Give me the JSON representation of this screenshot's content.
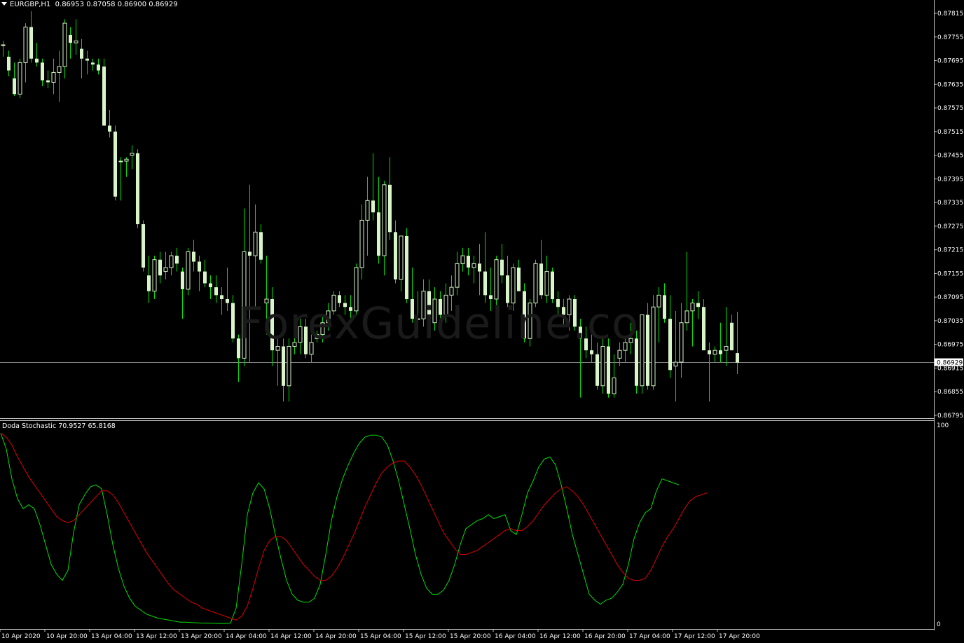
{
  "window": {
    "symbol": "EURGBP,H1",
    "ohlc": "0.86953 0.87058 0.86900 0.86929"
  },
  "watermark": "ForexGuideline.co",
  "indicator": {
    "label": "Doda Stochastic 70.9527 65.8168",
    "scale_top": "100",
    "scale_bottom": "0"
  },
  "price_axis": {
    "labels": [
      "0.87815",
      "0.87755",
      "0.87695",
      "0.87635",
      "0.87575",
      "0.87515",
      "0.87455",
      "0.87395",
      "0.87335",
      "0.87275",
      "0.87215",
      "0.87155",
      "0.87095",
      "0.87035",
      "0.86975",
      "0.86915",
      "0.86855",
      "0.86795"
    ],
    "current_price": "0.86929"
  },
  "time_axis": {
    "labels": [
      "10 Apr 2020",
      "10 Apr 20:00",
      "13 Apr 04:00",
      "13 Apr 12:00",
      "13 Apr 20:00",
      "14 Apr 04:00",
      "14 Apr 12:00",
      "14 Apr 20:00",
      "15 Apr 04:00",
      "15 Apr 12:00",
      "15 Apr 20:00",
      "16 Apr 04:00",
      "16 Apr 12:00",
      "16 Apr 20:00",
      "17 Apr 04:00",
      "17 Apr 12:00",
      "17 Apr 20:00"
    ]
  },
  "colors": {
    "background": "#000000",
    "candle": "#d8f5c8",
    "wick": "#00e000",
    "stoch_main": "#00e000",
    "stoch_signal": "#e00000",
    "price_line": "#b0b0b0"
  },
  "chart_data": [
    {
      "type": "candlestick",
      "title": "EURGBP,H1",
      "ylim": [
        0.86795,
        0.87835
      ],
      "candles": [
        [
          0.87735,
          0.87745,
          0.87705,
          0.87735
        ],
        [
          0.87705,
          0.8772,
          0.87655,
          0.8767
        ],
        [
          0.8765,
          0.8769,
          0.87605,
          0.8761
        ],
        [
          0.8761,
          0.877,
          0.876,
          0.8769
        ],
        [
          0.8769,
          0.8779,
          0.8764,
          0.8778
        ],
        [
          0.8778,
          0.8782,
          0.8769,
          0.877
        ],
        [
          0.877,
          0.8774,
          0.8768,
          0.8769
        ],
        [
          0.8769,
          0.877,
          0.8763,
          0.87645
        ],
        [
          0.87645,
          0.8767,
          0.87625,
          0.8764
        ],
        [
          0.8764,
          0.877,
          0.8761,
          0.87665
        ],
        [
          0.87665,
          0.8772,
          0.8759,
          0.8768
        ],
        [
          0.8768,
          0.878,
          0.8765,
          0.8779
        ],
        [
          0.8776,
          0.8778,
          0.877,
          0.8774
        ],
        [
          0.8774,
          0.878,
          0.8771,
          0.87745
        ],
        [
          0.87725,
          0.8775,
          0.8765,
          0.877
        ],
        [
          0.877,
          0.8772,
          0.8766,
          0.87695
        ],
        [
          0.8769,
          0.877,
          0.8767,
          0.87685
        ],
        [
          0.87685,
          0.877,
          0.8766,
          0.8767
        ],
        [
          0.8768,
          0.877,
          0.8753,
          0.8753
        ],
        [
          0.8753,
          0.8757,
          0.875,
          0.87515
        ],
        [
          0.87515,
          0.8753,
          0.8734,
          0.8735
        ],
        [
          0.8744,
          0.8745,
          0.8734,
          0.8744
        ],
        [
          0.8744,
          0.8745,
          0.874,
          0.87445
        ],
        [
          0.87455,
          0.8748,
          0.8742,
          0.8746
        ],
        [
          0.8746,
          0.8747,
          0.8727,
          0.8728
        ],
        [
          0.8728,
          0.8729,
          0.8716,
          0.8717
        ],
        [
          0.8715,
          0.872,
          0.8708,
          0.8711
        ],
        [
          0.8711,
          0.872,
          0.8709,
          0.8719
        ],
        [
          0.8719,
          0.8721,
          0.8713,
          0.8715
        ],
        [
          0.8716,
          0.8721,
          0.8714,
          0.8717
        ],
        [
          0.8717,
          0.8721,
          0.8715,
          0.872
        ],
        [
          0.872,
          0.8722,
          0.8716,
          0.8718
        ],
        [
          0.8716,
          0.8717,
          0.8704,
          0.87115
        ],
        [
          0.87115,
          0.8722,
          0.871,
          0.8721
        ],
        [
          0.8721,
          0.8724,
          0.8716,
          0.87185
        ],
        [
          0.87185,
          0.872,
          0.8711,
          0.8716
        ],
        [
          0.8716,
          0.8719,
          0.8712,
          0.8713
        ],
        [
          0.8713,
          0.8715,
          0.8709,
          0.8712
        ],
        [
          0.8712,
          0.8715,
          0.8708,
          0.871
        ],
        [
          0.871,
          0.8712,
          0.8705,
          0.8709
        ],
        [
          0.8709,
          0.8717,
          0.8706,
          0.8708
        ],
        [
          0.8708,
          0.871,
          0.8698,
          0.8699
        ],
        [
          0.8699,
          0.87,
          0.8688,
          0.8694
        ],
        [
          0.8694,
          0.8732,
          0.8692,
          0.8721
        ],
        [
          0.8721,
          0.8738,
          0.8693,
          0.872
        ],
        [
          0.872,
          0.8733,
          0.8707,
          0.8726
        ],
        [
          0.8726,
          0.8728,
          0.8718,
          0.8719
        ],
        [
          0.8708,
          0.872,
          0.87,
          0.8709
        ],
        [
          0.8709,
          0.8712,
          0.8692,
          0.8696
        ],
        [
          0.8696,
          0.8699,
          0.8687,
          0.8697
        ],
        [
          0.8697,
          0.8699,
          0.8683,
          0.8687
        ],
        [
          0.8687,
          0.8699,
          0.8683,
          0.8697
        ],
        [
          0.8697,
          0.8702,
          0.8695,
          0.8698
        ],
        [
          0.8698,
          0.8704,
          0.8695,
          0.8702
        ],
        [
          0.8702,
          0.8704,
          0.8694,
          0.8695
        ],
        [
          0.8695,
          0.87,
          0.8693,
          0.8698
        ],
        [
          0.8699,
          0.8701,
          0.8698,
          0.87
        ],
        [
          0.87,
          0.8705,
          0.8698,
          0.8703
        ],
        [
          0.8703,
          0.8708,
          0.8701,
          0.8706
        ],
        [
          0.8706,
          0.8711,
          0.8705,
          0.871
        ],
        [
          0.871,
          0.8711,
          0.8707,
          0.8708
        ],
        [
          0.8708,
          0.871,
          0.8705,
          0.8707
        ],
        [
          0.8707,
          0.871,
          0.8703,
          0.8706
        ],
        [
          0.8706,
          0.8718,
          0.8705,
          0.8717
        ],
        [
          0.8717,
          0.8733,
          0.8714,
          0.8729
        ],
        [
          0.8729,
          0.874,
          0.872,
          0.8734
        ],
        [
          0.8734,
          0.8746,
          0.8729,
          0.8731
        ],
        [
          0.8731,
          0.874,
          0.8718,
          0.872
        ],
        [
          0.872,
          0.8739,
          0.8715,
          0.8738
        ],
        [
          0.8738,
          0.8745,
          0.8724,
          0.8726
        ],
        [
          0.8726,
          0.8729,
          0.8713,
          0.8714
        ],
        [
          0.8714,
          0.8725,
          0.8711,
          0.8725
        ],
        [
          0.8725,
          0.8727,
          0.8708,
          0.8709
        ],
        [
          0.8709,
          0.8717,
          0.8703,
          0.8704
        ],
        [
          0.8704,
          0.8711,
          0.8701,
          0.8704
        ],
        [
          0.8704,
          0.8714,
          0.8702,
          0.8711
        ],
        [
          0.8711,
          0.8714,
          0.8702,
          0.8703
        ],
        [
          0.8703,
          0.8712,
          0.8701,
          0.8709
        ],
        [
          0.8709,
          0.8711,
          0.8704,
          0.8705
        ],
        [
          0.8705,
          0.8713,
          0.8703,
          0.871
        ],
        [
          0.871,
          0.8715,
          0.8706,
          0.8712
        ],
        [
          0.8712,
          0.8721,
          0.871,
          0.8718
        ],
        [
          0.8718,
          0.8722,
          0.8716,
          0.872
        ],
        [
          0.872,
          0.8722,
          0.8715,
          0.8717
        ],
        [
          0.8717,
          0.872,
          0.8713,
          0.8718
        ],
        [
          0.8718,
          0.8723,
          0.871,
          0.8716
        ],
        [
          0.8716,
          0.8726,
          0.8708,
          0.871
        ],
        [
          0.871,
          0.8717,
          0.8706,
          0.8709
        ],
        [
          0.8709,
          0.872,
          0.8705,
          0.8719
        ],
        [
          0.8719,
          0.8723,
          0.8713,
          0.8715
        ],
        [
          0.8715,
          0.872,
          0.8707,
          0.8708
        ],
        [
          0.8708,
          0.8718,
          0.8706,
          0.8717
        ],
        [
          0.8717,
          0.8719,
          0.8711,
          0.8711
        ],
        [
          0.8711,
          0.8713,
          0.8698,
          0.8699
        ],
        [
          0.8699,
          0.8709,
          0.8697,
          0.8708
        ],
        [
          0.8708,
          0.8719,
          0.8707,
          0.8718
        ],
        [
          0.8718,
          0.8724,
          0.8709,
          0.871
        ],
        [
          0.871,
          0.872,
          0.8708,
          0.8716
        ],
        [
          0.8716,
          0.8717,
          0.8708,
          0.8709
        ],
        [
          0.8709,
          0.8711,
          0.8705,
          0.8707
        ],
        [
          0.8707,
          0.8709,
          0.8702,
          0.8705
        ],
        [
          0.8705,
          0.871,
          0.8701,
          0.8709
        ],
        [
          0.8709,
          0.871,
          0.8701,
          0.8702
        ],
        [
          0.8702,
          0.8704,
          0.8684,
          0.8699
        ],
        [
          0.8699,
          0.8702,
          0.8694,
          0.8696
        ],
        [
          0.8696,
          0.87,
          0.8693,
          0.8695
        ],
        [
          0.8695,
          0.8698,
          0.8686,
          0.8687
        ],
        [
          0.8687,
          0.8699,
          0.8685,
          0.8697
        ],
        [
          0.8697,
          0.8699,
          0.8684,
          0.8685
        ],
        [
          0.8685,
          0.8695,
          0.8684,
          0.8689
        ],
        [
          0.8694,
          0.8698,
          0.8692,
          0.8696
        ],
        [
          0.8696,
          0.8699,
          0.8693,
          0.8698
        ],
        [
          0.8698,
          0.8703,
          0.8695,
          0.8699
        ],
        [
          0.8699,
          0.8701,
          0.8685,
          0.8687
        ],
        [
          0.8687,
          0.8705,
          0.8685,
          0.8705
        ],
        [
          0.8705,
          0.8708,
          0.8686,
          0.8687
        ],
        [
          0.8687,
          0.871,
          0.8686,
          0.8707
        ],
        [
          0.8707,
          0.8712,
          0.8698,
          0.871
        ],
        [
          0.871,
          0.8713,
          0.8703,
          0.8704
        ],
        [
          0.8704,
          0.871,
          0.8689,
          0.8691
        ],
        [
          0.8692,
          0.8706,
          0.8683,
          0.8693
        ],
        [
          0.8693,
          0.8708,
          0.8689,
          0.8703
        ],
        [
          0.8703,
          0.8721,
          0.8701,
          0.8706
        ],
        [
          0.8706,
          0.8709,
          0.8697,
          0.8708
        ],
        [
          0.8708,
          0.8711,
          0.8704,
          0.8707
        ],
        [
          0.8707,
          0.8709,
          0.8696,
          0.8696
        ],
        [
          0.8696,
          0.8698,
          0.8683,
          0.8695
        ],
        [
          0.8695,
          0.8697,
          0.8693,
          0.8696
        ],
        [
          0.8696,
          0.8703,
          0.8693,
          0.8695
        ],
        [
          0.8696,
          0.8707,
          0.8692,
          0.8697
        ],
        [
          0.8703,
          0.8705,
          0.8696,
          0.8696
        ],
        [
          0.86953,
          0.87058,
          0.869,
          0.86929
        ]
      ]
    },
    {
      "type": "line",
      "title": "Doda Stochastic 70.9527 65.8168",
      "ylim": [
        0,
        100
      ],
      "series": [
        {
          "values": [
            96,
            88,
            73,
            63,
            58,
            60,
            58,
            50,
            40,
            30,
            25,
            22,
            27,
            46,
            60,
            65,
            69,
            70,
            68,
            55,
            40,
            28,
            19,
            13,
            9,
            7,
            5,
            4,
            3,
            2.5,
            2,
            1.5,
            1,
            1,
            0.8,
            0.6,
            0.5,
            0.5,
            0.4,
            0.3,
            0.3,
            0.5,
            8,
            30,
            55,
            66,
            71,
            68,
            58,
            45,
            33,
            22,
            15,
            12,
            11,
            11,
            13,
            20,
            35,
            52,
            64,
            73,
            80,
            86,
            91,
            94,
            95,
            95,
            94,
            90,
            82,
            72,
            60,
            48,
            35,
            25,
            18,
            15,
            15,
            17,
            22,
            30,
            40,
            48,
            50,
            52,
            53,
            55,
            53,
            54,
            55,
            47,
            45,
            55,
            66,
            72,
            79,
            83,
            84,
            80,
            70,
            58,
            45,
            35,
            25,
            15,
            12,
            10,
            12,
            13,
            16,
            20,
            30,
            43,
            51,
            56,
            58,
            67,
            73,
            72,
            71,
            70
          ],
          "color": "#00e000"
        },
        {
          "values": [
            96,
            94,
            90,
            84,
            79,
            74,
            70,
            66,
            62,
            58,
            54,
            52,
            51,
            52,
            55,
            58,
            61,
            64,
            67,
            67,
            65,
            61,
            56,
            51,
            46,
            41,
            36,
            32,
            28,
            24,
            20,
            17,
            15,
            13,
            11,
            10,
            8,
            7,
            6,
            5,
            4,
            3,
            2,
            4,
            9,
            18,
            28,
            37,
            42,
            44,
            44,
            42,
            38,
            34,
            30,
            27,
            24,
            22,
            22,
            24,
            28,
            33,
            39,
            45,
            52,
            59,
            65,
            71,
            76,
            79,
            81,
            82,
            82,
            79,
            75,
            70,
            64,
            58,
            52,
            46,
            42,
            38,
            35,
            35,
            36,
            37,
            39,
            41,
            43,
            45,
            47,
            48,
            47,
            47,
            49,
            52,
            56,
            60,
            63,
            66,
            68,
            69,
            67,
            64,
            60,
            55,
            50,
            45,
            40,
            35,
            30,
            26,
            23,
            22,
            22,
            23,
            27,
            33,
            39,
            44,
            48,
            53,
            58,
            62,
            64,
            65,
            66
          ],
          "color": "#e00000"
        }
      ]
    }
  ]
}
